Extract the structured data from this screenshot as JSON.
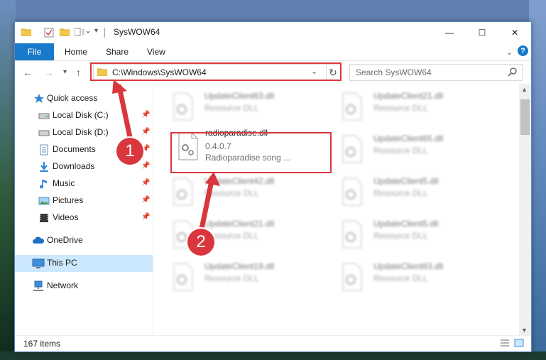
{
  "window": {
    "title": "SysWOW64",
    "controls": {
      "minimize": "—",
      "maximize": "☐",
      "close": "✕"
    }
  },
  "ribbon": {
    "tabs": [
      "File",
      "Home",
      "Share",
      "View"
    ],
    "help": "?"
  },
  "address": {
    "path": "C:\\Windows\\SysWOW64",
    "refresh_icon": "↻"
  },
  "search": {
    "placeholder": "Search SysWOW64"
  },
  "sidebar": {
    "items": [
      {
        "label": "Quick access",
        "icon": "star-icon"
      },
      {
        "label": "Local Disk (C:)",
        "icon": "drive-icon",
        "pinned": true
      },
      {
        "label": "Local Disk (D:)",
        "icon": "drive-icon",
        "pinned": true
      },
      {
        "label": "Documents",
        "icon": "documents-icon",
        "pinned": true
      },
      {
        "label": "Downloads",
        "icon": "download-icon",
        "pinned": true
      },
      {
        "label": "Music",
        "icon": "music-icon",
        "pinned": true
      },
      {
        "label": "Pictures",
        "icon": "pictures-icon",
        "pinned": true
      },
      {
        "label": "Videos",
        "icon": "videos-icon",
        "pinned": true
      },
      {
        "label": "OneDrive",
        "icon": "cloud-icon"
      },
      {
        "label": "This PC",
        "icon": "computer-icon",
        "selected": true
      },
      {
        "label": "Network",
        "icon": "network-icon"
      }
    ]
  },
  "files": {
    "left_column": [
      {
        "name": "UpdateClient63.dll",
        "type": "Resource DLL"
      },
      {
        "name": "radioparadise.dll",
        "version": "0.4.0.7",
        "description": "Radioparadise song ...",
        "highlighted": true
      },
      {
        "name": "UpdateClient42.dll",
        "type": "Resource DLL"
      },
      {
        "name": "UpdateClient21.dll",
        "type": "Resource DLL"
      },
      {
        "name": "UpdateClient19.dll",
        "type": "Resource DLL"
      }
    ],
    "right_column": [
      {
        "name": "UpdateClient21.dll",
        "type": "Resource DLL"
      },
      {
        "name": "UpdateClient65.dll",
        "type": "Resource DLL"
      },
      {
        "name": "UpdateClient5.dll",
        "type": "Resource DLL"
      },
      {
        "name": "UpdateClient5.dll",
        "type": "Resource DLL"
      },
      {
        "name": "UpdateClient63.dll",
        "type": "Resource DLL"
      }
    ]
  },
  "status": {
    "item_count": "167 items"
  },
  "callouts": [
    "1",
    "2"
  ],
  "colors": {
    "accent": "#1979ca",
    "highlight": "#d9363e",
    "selected": "#cce8ff"
  }
}
